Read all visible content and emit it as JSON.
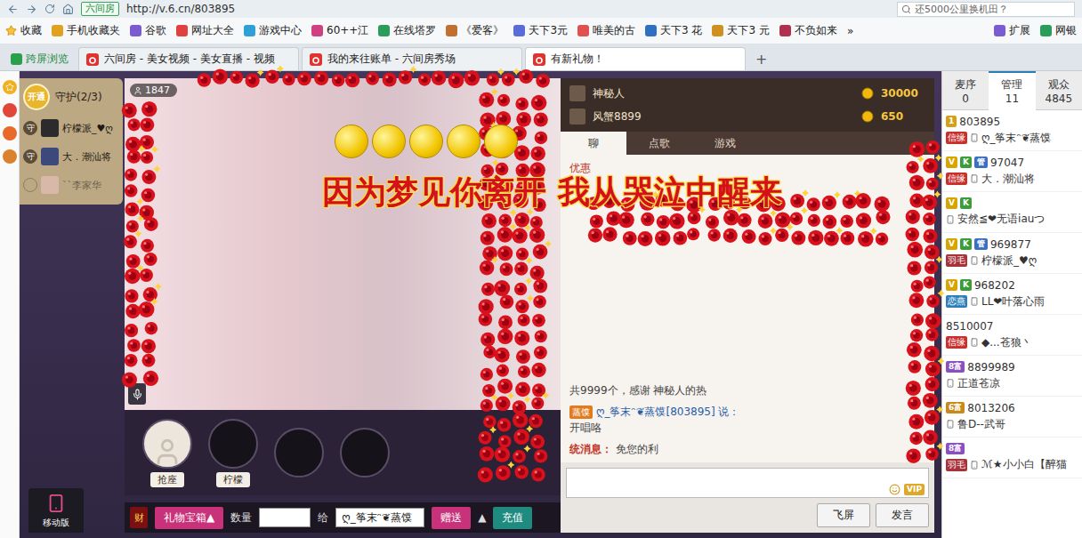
{
  "browser": {
    "site_badge": "六间房",
    "address": "http://v.6.cn/803895",
    "search": "还5000公里换机田？",
    "bookmarks": [
      "收藏",
      "手机收藏夹",
      "谷歌",
      "网址大全",
      "游戏中心",
      "60++江",
      "在线塔罗",
      "《爱客》",
      "天下3元",
      "唯美的古",
      "天下3 花",
      "天下3 元",
      "不负如来"
    ],
    "bookmarks_more": "»",
    "extras": [
      "扩展",
      "网银"
    ],
    "cross_screen": "跨屏浏览",
    "tabs": [
      {
        "label": "六间房 - 美女视频 - 美女直播 - 视频",
        "selected": false
      },
      {
        "label": "我的来往账单 - 六间房秀场",
        "selected": false
      },
      {
        "label": "有新礼物！",
        "selected": true
      }
    ],
    "new_tab": "+"
  },
  "mobile": "移动版",
  "guard": {
    "open": "开通",
    "title": "守护(2/3)",
    "mark": "守",
    "members": [
      {
        "name": "柠檬派_♥ღ",
        "guard": true
      },
      {
        "name": "大．潮汕将",
        "guard": true
      },
      {
        "name": "``李家华",
        "guard": false
      }
    ]
  },
  "video": {
    "viewers": "1847",
    "seats": [
      {
        "label": "抢座",
        "occupied": false
      },
      {
        "label": "柠檬",
        "occupied": true
      },
      {
        "occupied": true
      },
      {
        "occupied": true
      }
    ]
  },
  "gift_animation": {
    "lyric": "因为梦见你离开 我从哭泣中醒来",
    "coins": 5
  },
  "gift_bar": {
    "icon": "财",
    "box": "礼物宝箱▲",
    "qty_label": "数量",
    "to_label": "给",
    "recipient": "ღ_筝末ᵔ❦蒸馍",
    "send": "赠送",
    "send_menu": "▲",
    "recharge": "充值"
  },
  "chat": {
    "top": [
      {
        "name": "神秘人",
        "amount": "30000"
      },
      {
        "name": "风蟹8899",
        "amount": "650"
      }
    ],
    "tabs": [
      {
        "label": "聊",
        "selected": true
      },
      {
        "label": "点歌",
        "selected": false
      },
      {
        "label": "游戏",
        "selected": false
      }
    ],
    "notice": "优惠",
    "messages": [
      {
        "kind": "gift",
        "text": "共9999个，感谢 神秘人的热"
      },
      {
        "kind": "speech",
        "badge": "蒸馍",
        "speaker": "ღ_筝末ᵔ❦蒸馍[803895] 说：",
        "text": "开唱咯"
      },
      {
        "kind": "system",
        "label": "统消息：",
        "text": "免您的利"
      }
    ],
    "vip": "VIP",
    "buttons": [
      "飞屏",
      "发言"
    ]
  },
  "right_panel": {
    "tabs": [
      {
        "label": "麦序",
        "count": "0",
        "selected": false
      },
      {
        "label": "管理",
        "count": "11",
        "selected": true
      },
      {
        "label": "观众",
        "count": "4845",
        "selected": false
      }
    ],
    "users": [
      {
        "badges": [
          {
            "text": "1",
            "color": "#d4a017"
          }
        ],
        "id": "803895",
        "tag": "信缘",
        "tag_color": "#c9302c",
        "name": "ღ_筝末ᵔ❦蒸馍"
      },
      {
        "badges": [
          {
            "text": "V",
            "color": "#d9a400"
          },
          {
            "text": "K",
            "color": "#3a9d3a"
          },
          {
            "text": "管",
            "color": "#3b6fc4"
          }
        ],
        "id": "97047",
        "tag": "信缘",
        "tag_color": "#c9302c",
        "name": "大．潮汕将"
      },
      {
        "badges": [
          {
            "text": "V",
            "color": "#d9a400"
          },
          {
            "text": "K",
            "color": "#3a9d3a"
          }
        ],
        "name": "安然≦❤无语iauつ"
      },
      {
        "badges": [
          {
            "text": "V",
            "color": "#d9a400"
          },
          {
            "text": "K",
            "color": "#3a9d3a"
          },
          {
            "text": "管",
            "color": "#3b6fc4"
          }
        ],
        "id": "969877",
        "tag": "羽毛",
        "tag_color": "#a8323a",
        "name": "柠檬派_♥ღ"
      },
      {
        "badges": [
          {
            "text": "V",
            "color": "#d9a400"
          },
          {
            "text": "K",
            "color": "#3a9d3a"
          }
        ],
        "id": "968202",
        "tag": "恋燕",
        "tag_color": "#2a7fb8",
        "name": "LL❤叶落心雨"
      },
      {
        "badges": [],
        "id": "8510007",
        "tag": "信缘",
        "tag_color": "#c9302c",
        "name": "◆...苍狼丶"
      },
      {
        "badges": [
          {
            "text": "8富",
            "color": "#8a4fc0"
          }
        ],
        "id": "8899989",
        "name": "正道苍凉"
      },
      {
        "badges": [
          {
            "text": "6富",
            "color": "#c98a1a"
          }
        ],
        "id": "8013206",
        "name": "鲁D--武哥"
      },
      {
        "badges": [
          {
            "text": "8富",
            "color": "#8a4fc0"
          }
        ],
        "tag": "羽毛",
        "tag_color": "#a8323a",
        "name": "ℳ★小小白【醉猫"
      }
    ]
  }
}
